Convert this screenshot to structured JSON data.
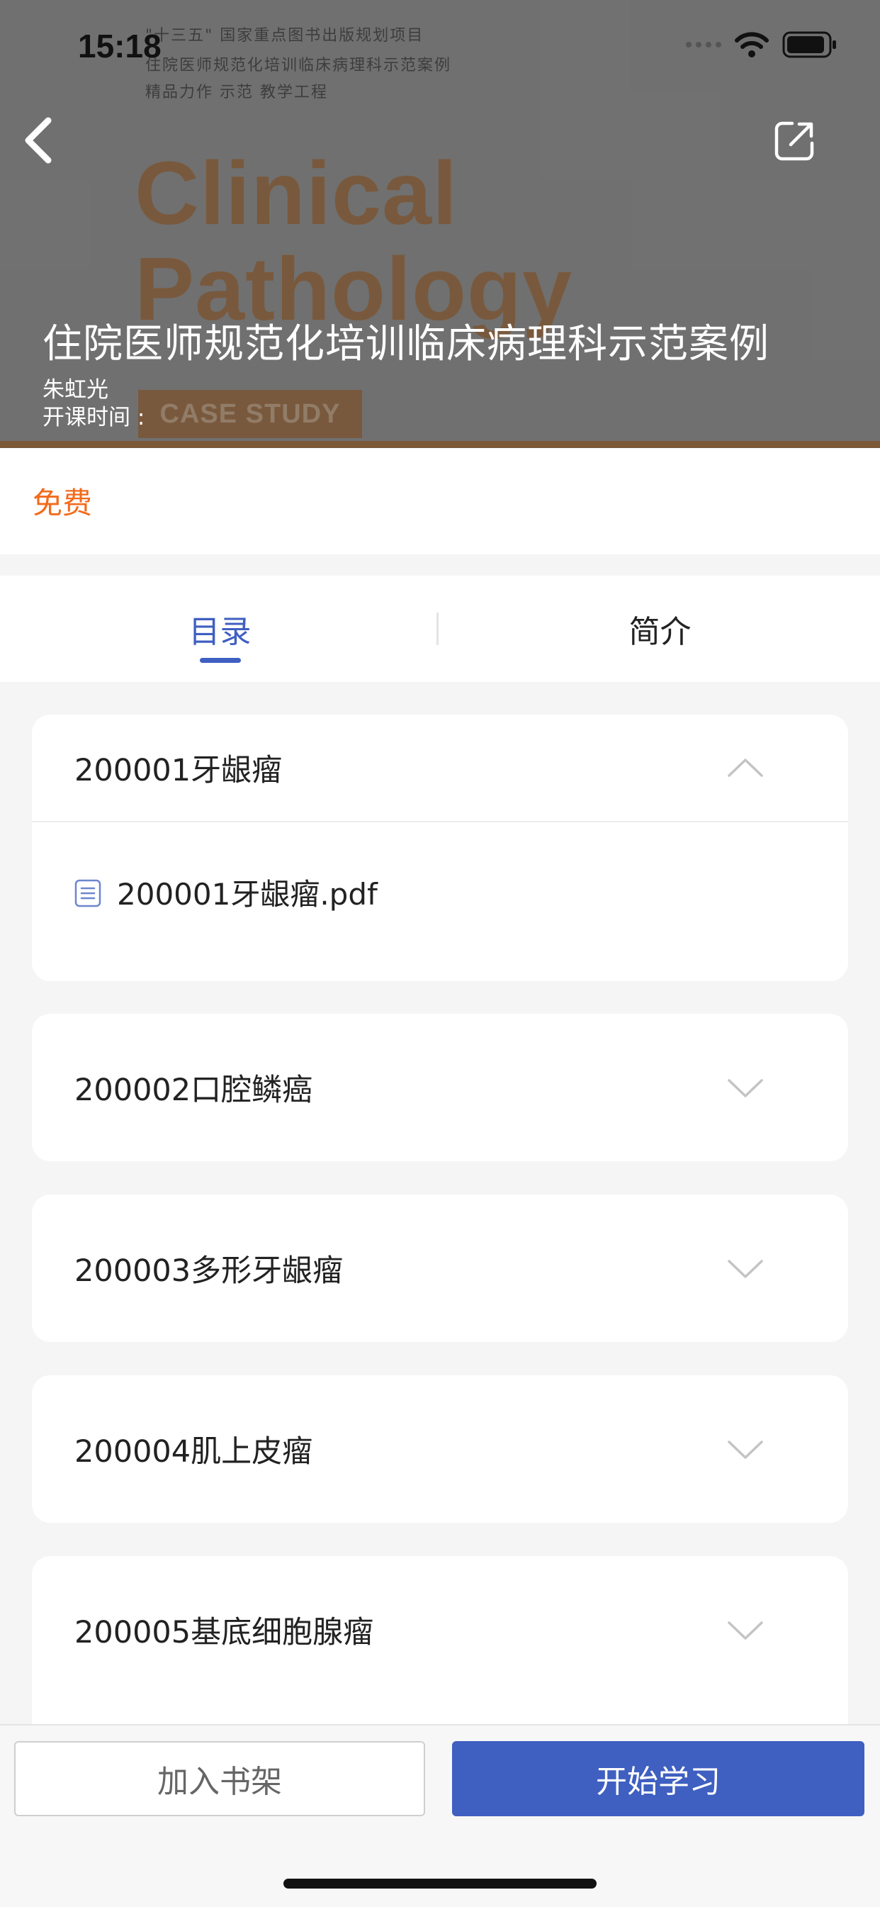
{
  "status_bar": {
    "time": "15:18"
  },
  "cover": {
    "fine_lines": [
      "\"十三五\" 国家重点图书出版规划项目",
      "住院医师规范化培训临床病理科示范案例",
      "精品力作 示范 教学工程"
    ],
    "word_1": "Clinical",
    "word_2": "Pathology",
    "badge": "CASE STUDY"
  },
  "header": {
    "back_icon": "chevron-left-icon",
    "share_icon": "share-icon",
    "title": "住院医师规范化培训临床病理科示范案例",
    "author": "朱虹光",
    "time_label": "开课时间 :"
  },
  "price": {
    "label": "免费",
    "color": "#f26b1d"
  },
  "tabs": [
    {
      "label": "目录",
      "active": true
    },
    {
      "label": "简介",
      "active": false
    }
  ],
  "chapters": [
    {
      "title": "200001牙龈瘤",
      "expanded": true,
      "files": [
        {
          "name": "200001牙龈瘤.pdf",
          "icon": "document-icon"
        }
      ]
    },
    {
      "title": "200002口腔鳞癌",
      "expanded": false
    },
    {
      "title": "200003多形牙龈瘤",
      "expanded": false
    },
    {
      "title": "200004肌上皮瘤",
      "expanded": false
    },
    {
      "title": "200005基底细胞腺瘤",
      "expanded": false
    }
  ],
  "actions": {
    "add_to_shelf": "加入书架",
    "start_learning": "开始学习"
  },
  "colors": {
    "accent": "#3f5fc1",
    "price": "#f26b1d",
    "background": "#f5f5f5"
  }
}
